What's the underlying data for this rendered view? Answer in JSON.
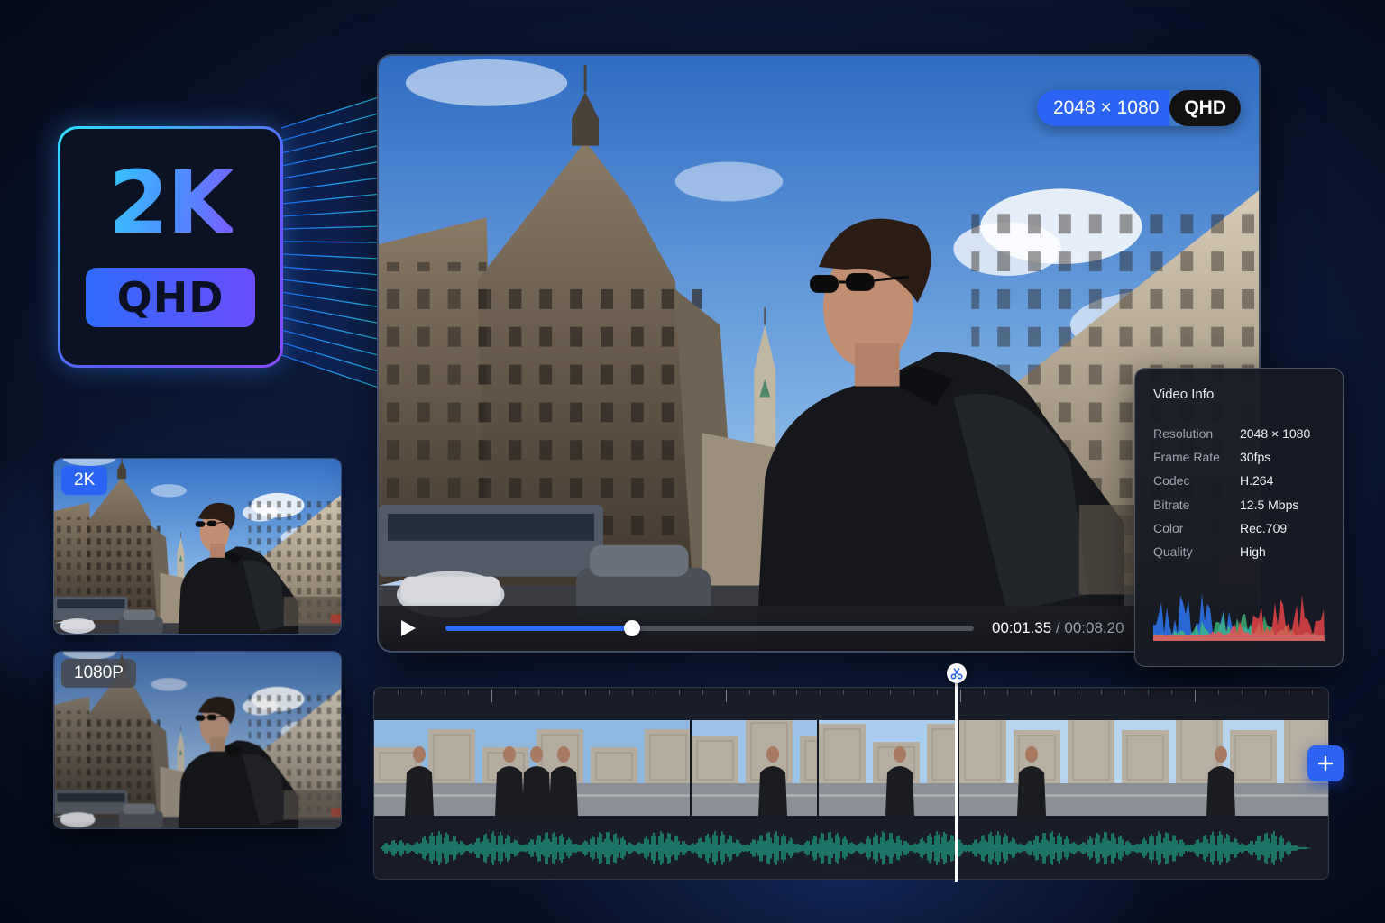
{
  "badge": {
    "resolution": "2K",
    "standard": "QHD"
  },
  "player": {
    "resolution_tag": "2048 × 1080",
    "quality_tag": "QHD",
    "current_time": "00:01.35",
    "separator": "/",
    "duration": "00:08.20",
    "progress": 0.354
  },
  "video_info": {
    "title": "Video Info",
    "rows": [
      {
        "label": "Resolution",
        "value": "2048 × 1080"
      },
      {
        "label": "Frame Rate",
        "value": "30fps"
      },
      {
        "label": "Codec",
        "value": "H.264"
      },
      {
        "label": "Bitrate",
        "value": "12.5 Mbps"
      },
      {
        "label": "Color",
        "value": "Rec.709"
      },
      {
        "label": "Quality",
        "value": "High"
      }
    ],
    "histogram_colors": [
      "#2f7dff",
      "#3cc07a",
      "#ff4a4a"
    ]
  },
  "thumbnails": [
    {
      "label": "2K"
    },
    {
      "label": "1080P"
    }
  ],
  "timeline": {
    "clips": 4,
    "playhead_icon": "scissors-icon",
    "add_icon": "plus-icon",
    "waveform_color": "#1fae8f"
  },
  "colors": {
    "accent": "#2b63f5",
    "background": "#0c1a38"
  }
}
